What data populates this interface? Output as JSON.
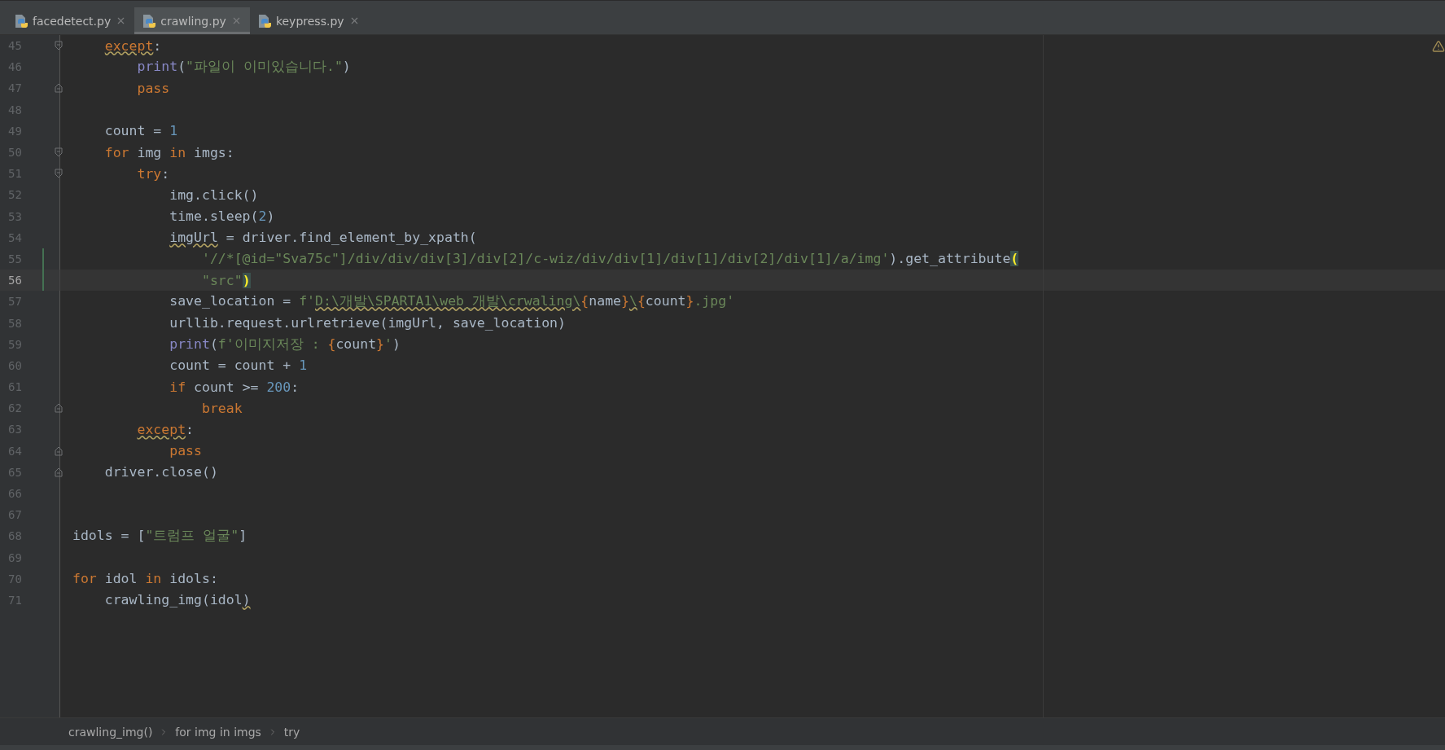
{
  "tabs": [
    {
      "label": "facedetect.py",
      "selected": false
    },
    {
      "label": "crawling.py",
      "selected": true
    },
    {
      "label": "keypress.py",
      "selected": false
    }
  ],
  "editor": {
    "lines": [
      {
        "number": "45",
        "current": false,
        "modified": false,
        "fold": {
          "kind": "open"
        },
        "tokens": [
          {
            "kind": "keyword-warn",
            "text": "    except"
          },
          {
            "kind": "plain",
            "text": ":"
          }
        ]
      },
      {
        "number": "46",
        "current": false,
        "modified": false,
        "tokens": [
          {
            "kind": "builtin",
            "text": "        print"
          },
          {
            "kind": "plain",
            "text": "("
          },
          {
            "kind": "string",
            "text": "\"파일이 이미있습니다.\""
          },
          {
            "kind": "plain",
            "text": ")"
          }
        ]
      },
      {
        "number": "47",
        "current": false,
        "modified": false,
        "fold": {
          "kind": "close"
        },
        "tokens": [
          {
            "kind": "keyword",
            "text": "        pass"
          }
        ]
      },
      {
        "number": "48",
        "current": false,
        "modified": false
      },
      {
        "number": "49",
        "current": false,
        "modified": false,
        "tokens": [
          {
            "kind": "plain",
            "text": "    count = "
          },
          {
            "kind": "number",
            "text": "1"
          }
        ]
      },
      {
        "number": "50",
        "current": false,
        "modified": false,
        "fold": {
          "kind": "open"
        },
        "tokens": [
          {
            "kind": "keyword",
            "text": "    for"
          },
          {
            "kind": "plain",
            "text": " img "
          },
          {
            "kind": "keyword",
            "text": "in"
          },
          {
            "kind": "plain",
            "text": " imgs:"
          }
        ]
      },
      {
        "number": "51",
        "current": false,
        "modified": false,
        "fold": {
          "kind": "open"
        },
        "tokens": [
          {
            "kind": "keyword",
            "text": "        try"
          },
          {
            "kind": "plain",
            "text": ":"
          }
        ]
      },
      {
        "number": "52",
        "current": false,
        "modified": false,
        "tokens": [
          {
            "kind": "plain",
            "text": "            img.click()"
          }
        ]
      },
      {
        "number": "53",
        "current": false,
        "modified": false,
        "tokens": [
          {
            "kind": "plain",
            "text": "            time.sleep("
          },
          {
            "kind": "number",
            "text": "2"
          },
          {
            "kind": "plain",
            "text": ")"
          }
        ]
      },
      {
        "number": "54",
        "current": false,
        "modified": false,
        "tokens": [
          {
            "kind": "plain-warn",
            "text": "            imgUrl"
          },
          {
            "kind": "plain",
            "text": " = driver.find_element_by_xpath("
          }
        ]
      },
      {
        "number": "55",
        "current": false,
        "modified": true,
        "tokens": [
          {
            "kind": "string",
            "text": "                '//*[@id=\"Sva75c\"]/div/div/div[3]/div[2]/c-wiz/div/div[1]/div[1]/div[2]/div[1]/a/img'"
          },
          {
            "kind": "plain",
            "text": ").get_attribute"
          },
          {
            "kind": "match",
            "text": "("
          }
        ]
      },
      {
        "number": "56",
        "current": true,
        "modified": true,
        "tokens": [
          {
            "kind": "string",
            "text": "                \"src\""
          },
          {
            "kind": "match",
            "text": ")"
          }
        ]
      },
      {
        "number": "57",
        "current": false,
        "modified": false,
        "tokens": [
          {
            "kind": "plain",
            "text": "            save_location = "
          },
          {
            "kind": "string",
            "text": "f'"
          },
          {
            "kind": "string-warn",
            "text": "D:\\개발\\SPARTA1\\web_개발\\crwaling\\"
          },
          {
            "kind": "keyword",
            "text": "{"
          },
          {
            "kind": "plain",
            "text": "name"
          },
          {
            "kind": "keyword",
            "text": "}"
          },
          {
            "kind": "string-warn",
            "text": "\\"
          },
          {
            "kind": "keyword",
            "text": "{"
          },
          {
            "kind": "plain",
            "text": "count"
          },
          {
            "kind": "keyword",
            "text": "}"
          },
          {
            "kind": "string",
            "text": ".jpg'"
          }
        ]
      },
      {
        "number": "58",
        "current": false,
        "modified": false,
        "tokens": [
          {
            "kind": "plain",
            "text": "            urllib.request.urlretrieve(imgUrl, save_location)"
          }
        ]
      },
      {
        "number": "59",
        "current": false,
        "modified": false,
        "tokens": [
          {
            "kind": "builtin",
            "text": "            print"
          },
          {
            "kind": "plain",
            "text": "("
          },
          {
            "kind": "string",
            "text": "f'이미지저장 : "
          },
          {
            "kind": "keyword",
            "text": "{"
          },
          {
            "kind": "plain",
            "text": "count"
          },
          {
            "kind": "keyword",
            "text": "}"
          },
          {
            "kind": "string",
            "text": "'"
          },
          {
            "kind": "plain",
            "text": ")"
          }
        ]
      },
      {
        "number": "60",
        "current": false,
        "modified": false,
        "tokens": [
          {
            "kind": "plain",
            "text": "            count = count + "
          },
          {
            "kind": "number",
            "text": "1"
          }
        ]
      },
      {
        "number": "61",
        "current": false,
        "modified": false,
        "tokens": [
          {
            "kind": "keyword",
            "text": "            if"
          },
          {
            "kind": "plain",
            "text": " count >= "
          },
          {
            "kind": "number",
            "text": "200"
          },
          {
            "kind": "plain",
            "text": ":"
          }
        ]
      },
      {
        "number": "62",
        "current": false,
        "modified": false,
        "fold": {
          "kind": "close"
        },
        "tokens": [
          {
            "kind": "keyword",
            "text": "                break"
          }
        ]
      },
      {
        "number": "63",
        "current": false,
        "modified": false,
        "tokens": [
          {
            "kind": "keyword-warn",
            "text": "        except"
          },
          {
            "kind": "plain",
            "text": ":"
          }
        ]
      },
      {
        "number": "64",
        "current": false,
        "modified": false,
        "fold": {
          "kind": "close"
        },
        "tokens": [
          {
            "kind": "keyword",
            "text": "            pass"
          }
        ]
      },
      {
        "number": "65",
        "current": false,
        "modified": false,
        "fold": {
          "kind": "close"
        },
        "tokens": [
          {
            "kind": "plain",
            "text": "    driver.close()"
          }
        ]
      },
      {
        "number": "66",
        "current": false,
        "modified": false
      },
      {
        "number": "67",
        "current": false,
        "modified": false
      },
      {
        "number": "68",
        "current": false,
        "modified": false,
        "tokens": [
          {
            "kind": "plain",
            "text": "idols = ["
          },
          {
            "kind": "string",
            "text": "\"트럼프 얼굴\""
          },
          {
            "kind": "plain",
            "text": "]"
          }
        ]
      },
      {
        "number": "69",
        "current": false,
        "modified": false
      },
      {
        "number": "70",
        "current": false,
        "modified": false,
        "tokens": [
          {
            "kind": "keyword",
            "text": "for"
          },
          {
            "kind": "plain",
            "text": " idol "
          },
          {
            "kind": "keyword",
            "text": "in"
          },
          {
            "kind": "plain",
            "text": " idols:"
          }
        ]
      },
      {
        "number": "71",
        "current": false,
        "modified": false,
        "tokens": [
          {
            "kind": "plain",
            "text": "    crawling_img(idol"
          },
          {
            "kind": "plain-warn",
            "text": ")"
          }
        ]
      }
    ]
  },
  "breadcrumbs": [
    "crawling_img()",
    "for img in imgs",
    "try"
  ]
}
